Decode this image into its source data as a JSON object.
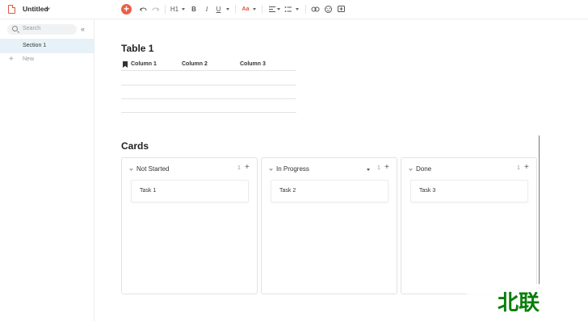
{
  "header": {
    "doc_title": "Untitled",
    "toolbar": {
      "heading_label": "H1",
      "bold_label": "B",
      "italic_label": "I",
      "underline_label": "U",
      "font_color_label": "Aa"
    }
  },
  "sidebar": {
    "search_placeholder": "Search",
    "items": [
      {
        "label": "Section 1",
        "selected": true
      }
    ],
    "new_label": "New"
  },
  "table": {
    "title": "Table 1",
    "columns": [
      "Column 1",
      "Column 2",
      "Column 3"
    ],
    "rows": [
      [
        "",
        "",
        ""
      ],
      [
        "",
        "",
        ""
      ],
      [
        "",
        "",
        ""
      ]
    ]
  },
  "cards": {
    "title": "Cards",
    "columns": [
      {
        "title": "Not Started",
        "count": "1",
        "cards": [
          "Task 1"
        ]
      },
      {
        "title": "In Progress",
        "count": "1",
        "cards": [
          "Task 2"
        ]
      },
      {
        "title": "Done",
        "count": "1",
        "cards": [
          "Task 3"
        ]
      }
    ]
  },
  "watermark": {
    "text": "北联"
  },
  "colors": {
    "accent": "#ec5f45",
    "selected_bg": "#e6f2f7",
    "watermark": "#0a7d0a"
  }
}
